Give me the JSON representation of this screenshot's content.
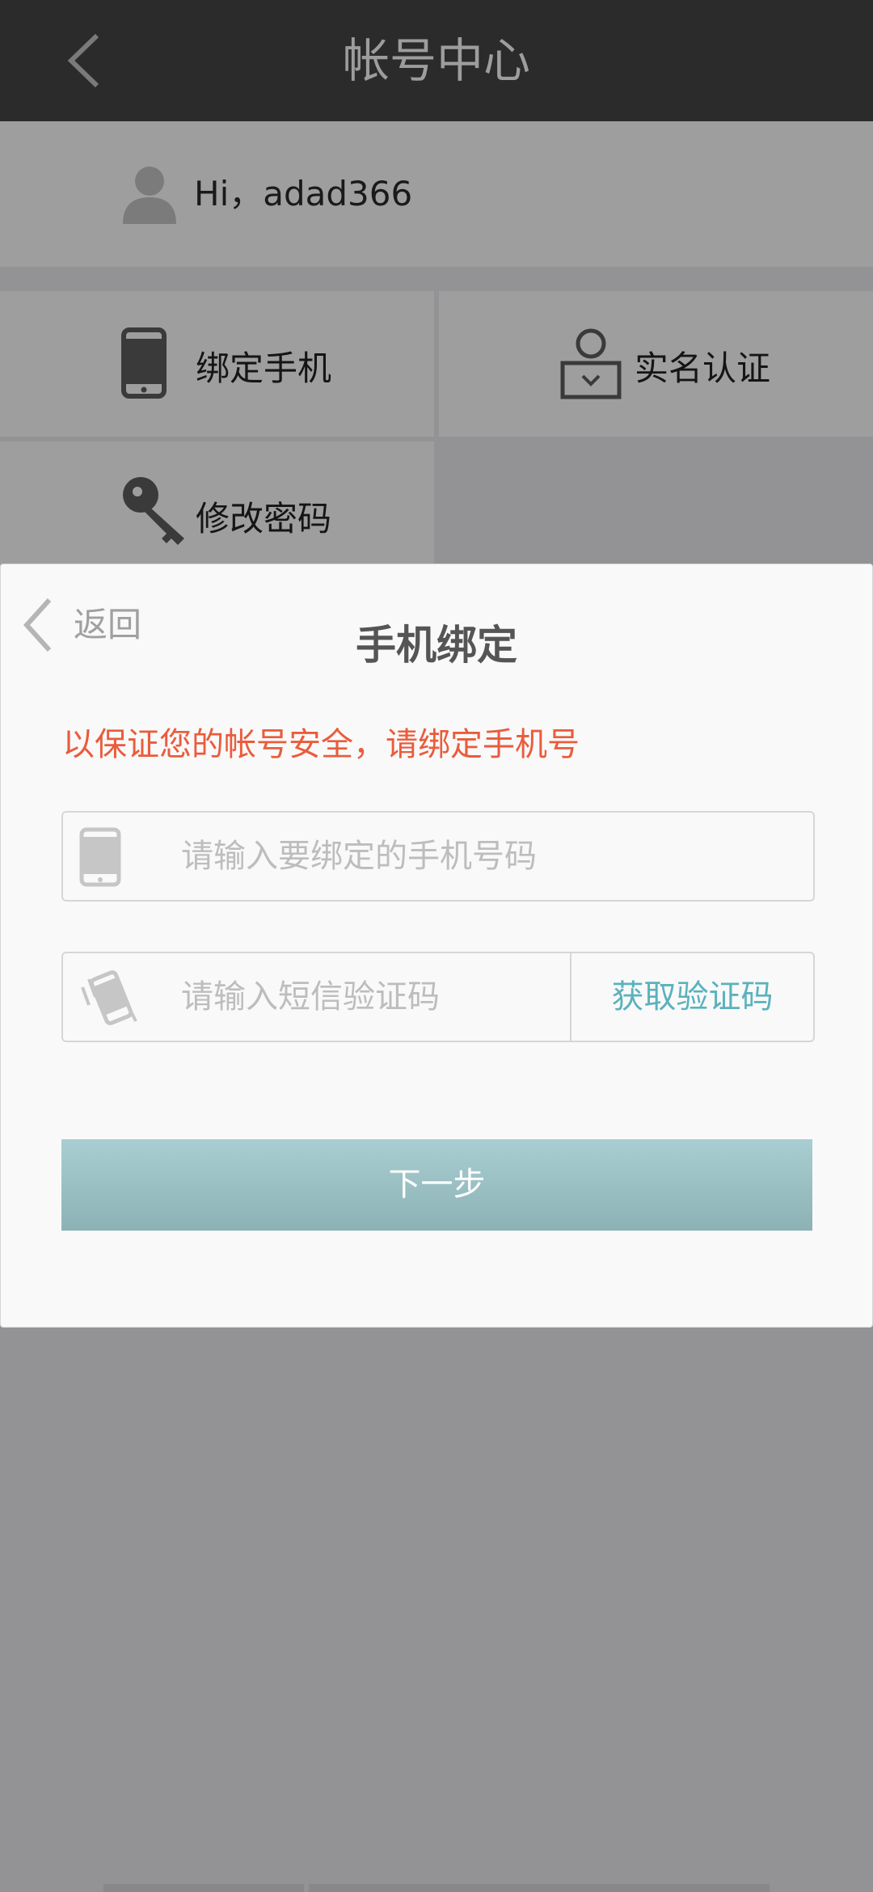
{
  "topbar": {
    "title": "帐号中心",
    "back_icon": "chevron-left-icon"
  },
  "greeting": {
    "text": "Hi，adad366",
    "icon": "user-avatar-icon"
  },
  "tiles": [
    {
      "label": "绑定手机",
      "icon": "phone-icon"
    },
    {
      "label": "实名认证",
      "icon": "id-card-icon"
    },
    {
      "label": "修改密码",
      "icon": "key-icon"
    }
  ],
  "modal": {
    "back_label": "返回",
    "title": "手机绑定",
    "notice": "以保证您的帐号安全，请绑定手机号",
    "phone_field": {
      "placeholder": "请输入要绑定的手机号码",
      "value": "",
      "icon": "phone-icon"
    },
    "code_field": {
      "placeholder": "请输入短信验证码",
      "value": "",
      "icon": "vibrating-phone-icon"
    },
    "get_code_label": "获取验证码",
    "next_label": "下一步"
  },
  "colors": {
    "notice": "#ea5c3c",
    "accent": "#5ab2bd",
    "topbar": "#2b2b2b",
    "button": "#9fc4c8"
  }
}
